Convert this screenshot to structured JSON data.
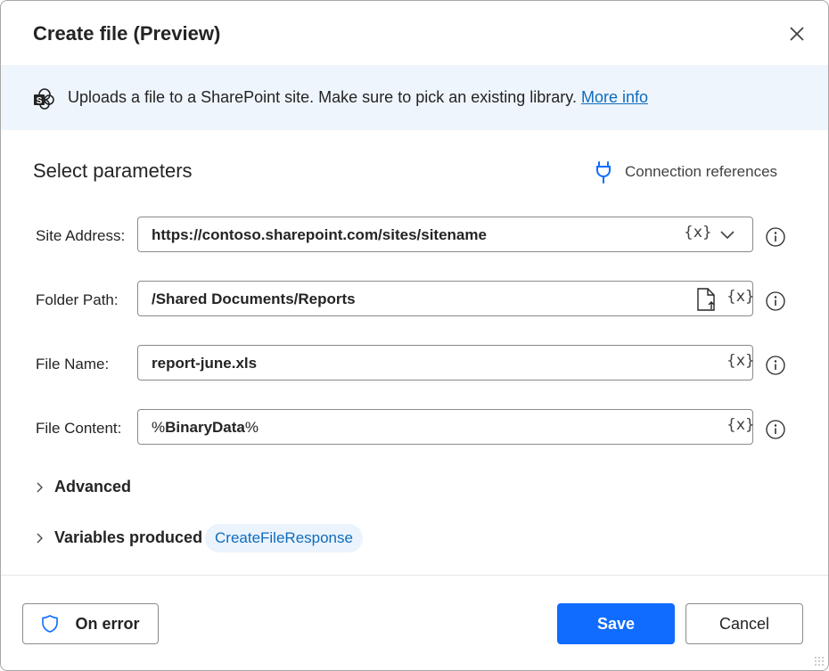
{
  "dialog": {
    "title": "Create file (Preview)",
    "close_label": "Close"
  },
  "banner": {
    "icon": "sharepoint-icon",
    "text": "Uploads a file to a SharePoint site. Make sure to pick an existing library.",
    "link": "More info"
  },
  "parameters": {
    "section_title": "Select parameters",
    "connection_references": "Connection references",
    "fields": [
      {
        "label": "Site Address:",
        "value": "https://contoso.sharepoint.com/sites/sitename",
        "var_token": "{x}",
        "has_dropdown": true
      },
      {
        "label": "Folder Path:",
        "value": "/Shared Documents/Reports",
        "var_token": "{x}",
        "has_file_picker": true
      },
      {
        "label": "File Name:",
        "value": "report-june.xls",
        "var_token": "{x}"
      },
      {
        "label": "File Content:",
        "value_prefix": "%",
        "value_main": "BinaryData",
        "value_suffix": "%",
        "var_token": "{x}"
      }
    ]
  },
  "advanced": {
    "label": "Advanced"
  },
  "variables": {
    "label": "Variables produced",
    "chip": "CreateFileResponse"
  },
  "footer": {
    "on_error": "On error",
    "save": "Save",
    "cancel": "Cancel"
  },
  "colors": {
    "accent": "#0f6cff",
    "link": "#0f6cbd",
    "banner_bg": "#eff5fd",
    "chip_bg": "#ebf3fc"
  }
}
